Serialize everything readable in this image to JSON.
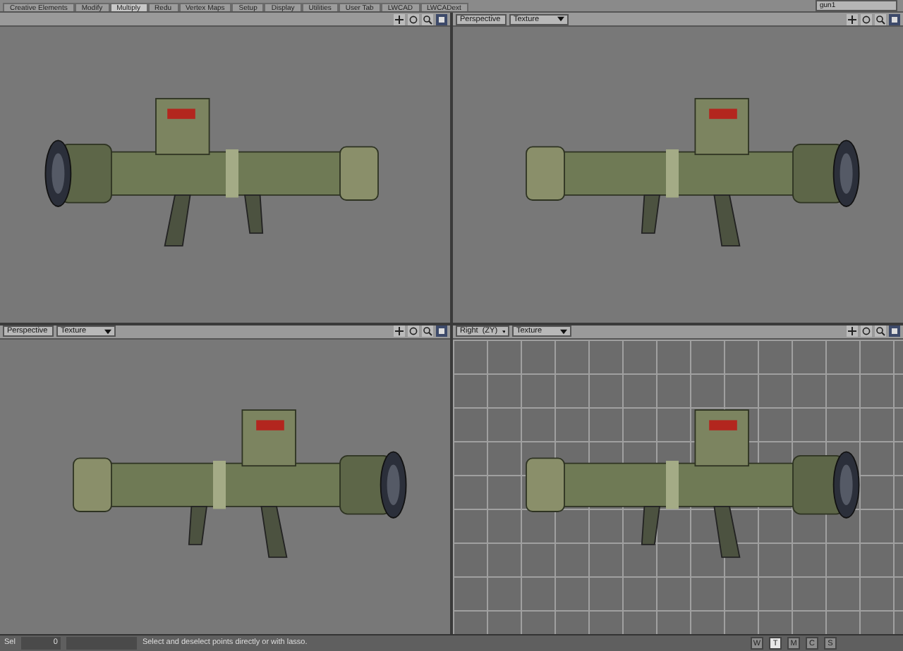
{
  "tabs": [
    {
      "label": "Creative Elements",
      "selected": false
    },
    {
      "label": "Modify",
      "selected": false
    },
    {
      "label": "Multiply",
      "selected": true
    },
    {
      "label": "Redu",
      "selected": false
    },
    {
      "label": "Vertex Maps",
      "selected": false
    },
    {
      "label": "Setup",
      "selected": false
    },
    {
      "label": "Display",
      "selected": false
    },
    {
      "label": "Utilities",
      "selected": false
    },
    {
      "label": "User Tab",
      "selected": false
    },
    {
      "label": "LWCAD",
      "selected": false
    },
    {
      "label": "LWCADext",
      "selected": false
    }
  ],
  "object_selector": {
    "value": "gun1"
  },
  "viewports": [
    {
      "grid": false,
      "mirrored": false,
      "maximized": true
    },
    {
      "view": "Perspective",
      "shading": "Texture",
      "grid": false,
      "mirrored": true,
      "maximized": true
    },
    {
      "view": "Perspective",
      "shading": "Texture",
      "grid": false,
      "mirrored": true,
      "maximized": true
    },
    {
      "view": "Right",
      "axes": "(ZY)",
      "shading": "Texture",
      "grid": true,
      "mirrored": true,
      "maximized": true
    }
  ],
  "status_bar": {
    "label": "Sel",
    "count": "0",
    "message": "Select and deselect points directly or with lasso.",
    "modes": [
      {
        "label": "W",
        "selected": false
      },
      {
        "label": "T",
        "selected": true
      },
      {
        "label": "M",
        "selected": false
      },
      {
        "label": "C",
        "selected": false
      },
      {
        "label": "S",
        "selected": false
      }
    ]
  }
}
